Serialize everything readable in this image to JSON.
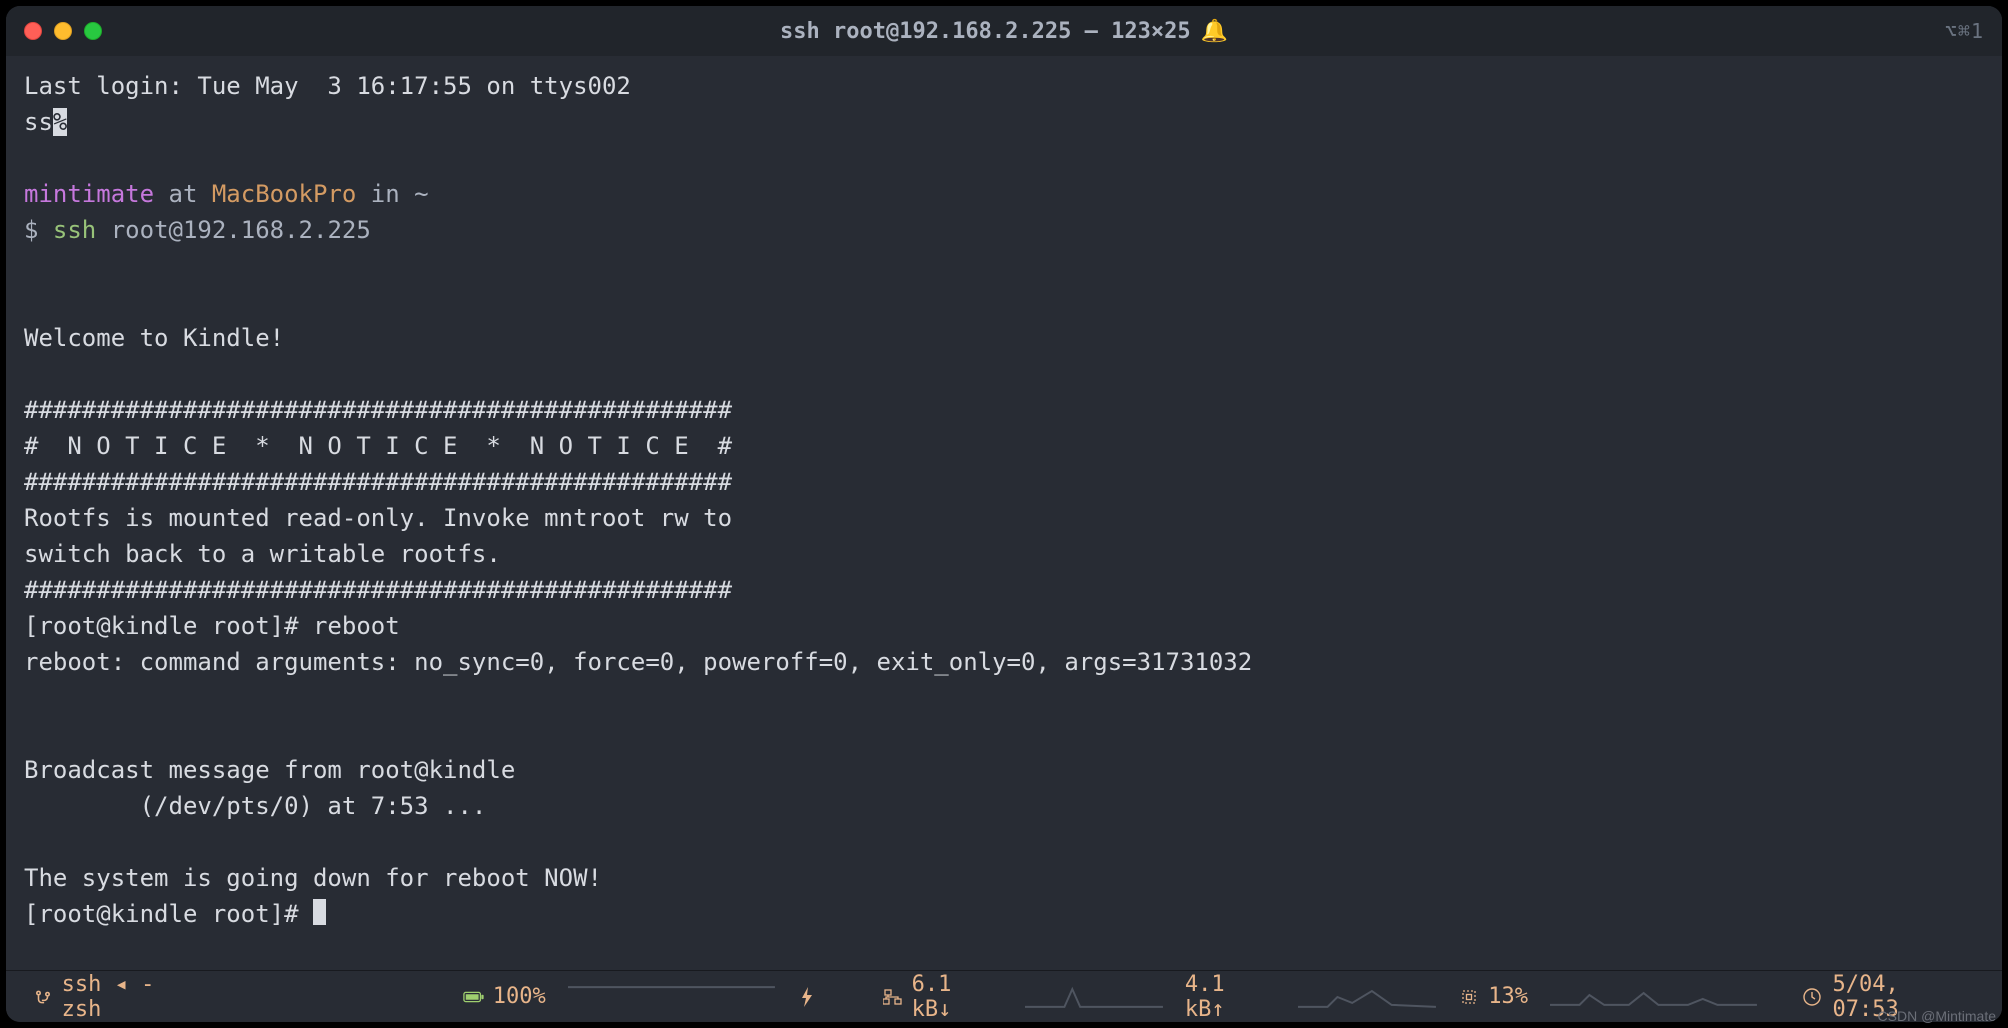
{
  "window": {
    "title": "ssh root@192.168.2.225 — 123×25",
    "shortcut_hint": "⌥⌘1"
  },
  "session": {
    "last_login": "Last login: Tue May  3 16:17:55 on ttys002",
    "partial": "ss",
    "prompt_user": "mintimate",
    "prompt_at": " at ",
    "prompt_host": "MacBookPro",
    "prompt_in": " in ",
    "prompt_path": "~",
    "prompt_symbol": "$ ",
    "cmd_name": "ssh",
    "cmd_args": " root@192.168.2.225",
    "welcome": "Welcome to Kindle!",
    "hash_line": "#################################################",
    "notice_line": "#  N O T I C E  *  N O T I C E  *  N O T I C E  #",
    "rootfs_1": "Rootfs is mounted read-only. Invoke mntroot rw to",
    "rootfs_2": "switch back to a writable rootfs.",
    "kindle_prompt1": "[root@kindle root]# reboot",
    "reboot_out": "reboot: command arguments: no_sync=0, force=0, poweroff=0, exit_only=0, args=31731032",
    "broadcast_1": "Broadcast message from root@kindle",
    "broadcast_2": "        (/dev/pts/0) at 7:53 ...",
    "going_down": "The system is going down for reboot NOW!",
    "kindle_prompt2": "[root@kindle root]# "
  },
  "statusbar": {
    "process": "ssh ◂ -zsh",
    "battery": "100%",
    "net_down": "6.1 kB↓",
    "net_up": "4.1 kB↑",
    "cpu": "13%",
    "datetime": "5/04, 07:53"
  },
  "watermark": "CSDN @Mintimate"
}
